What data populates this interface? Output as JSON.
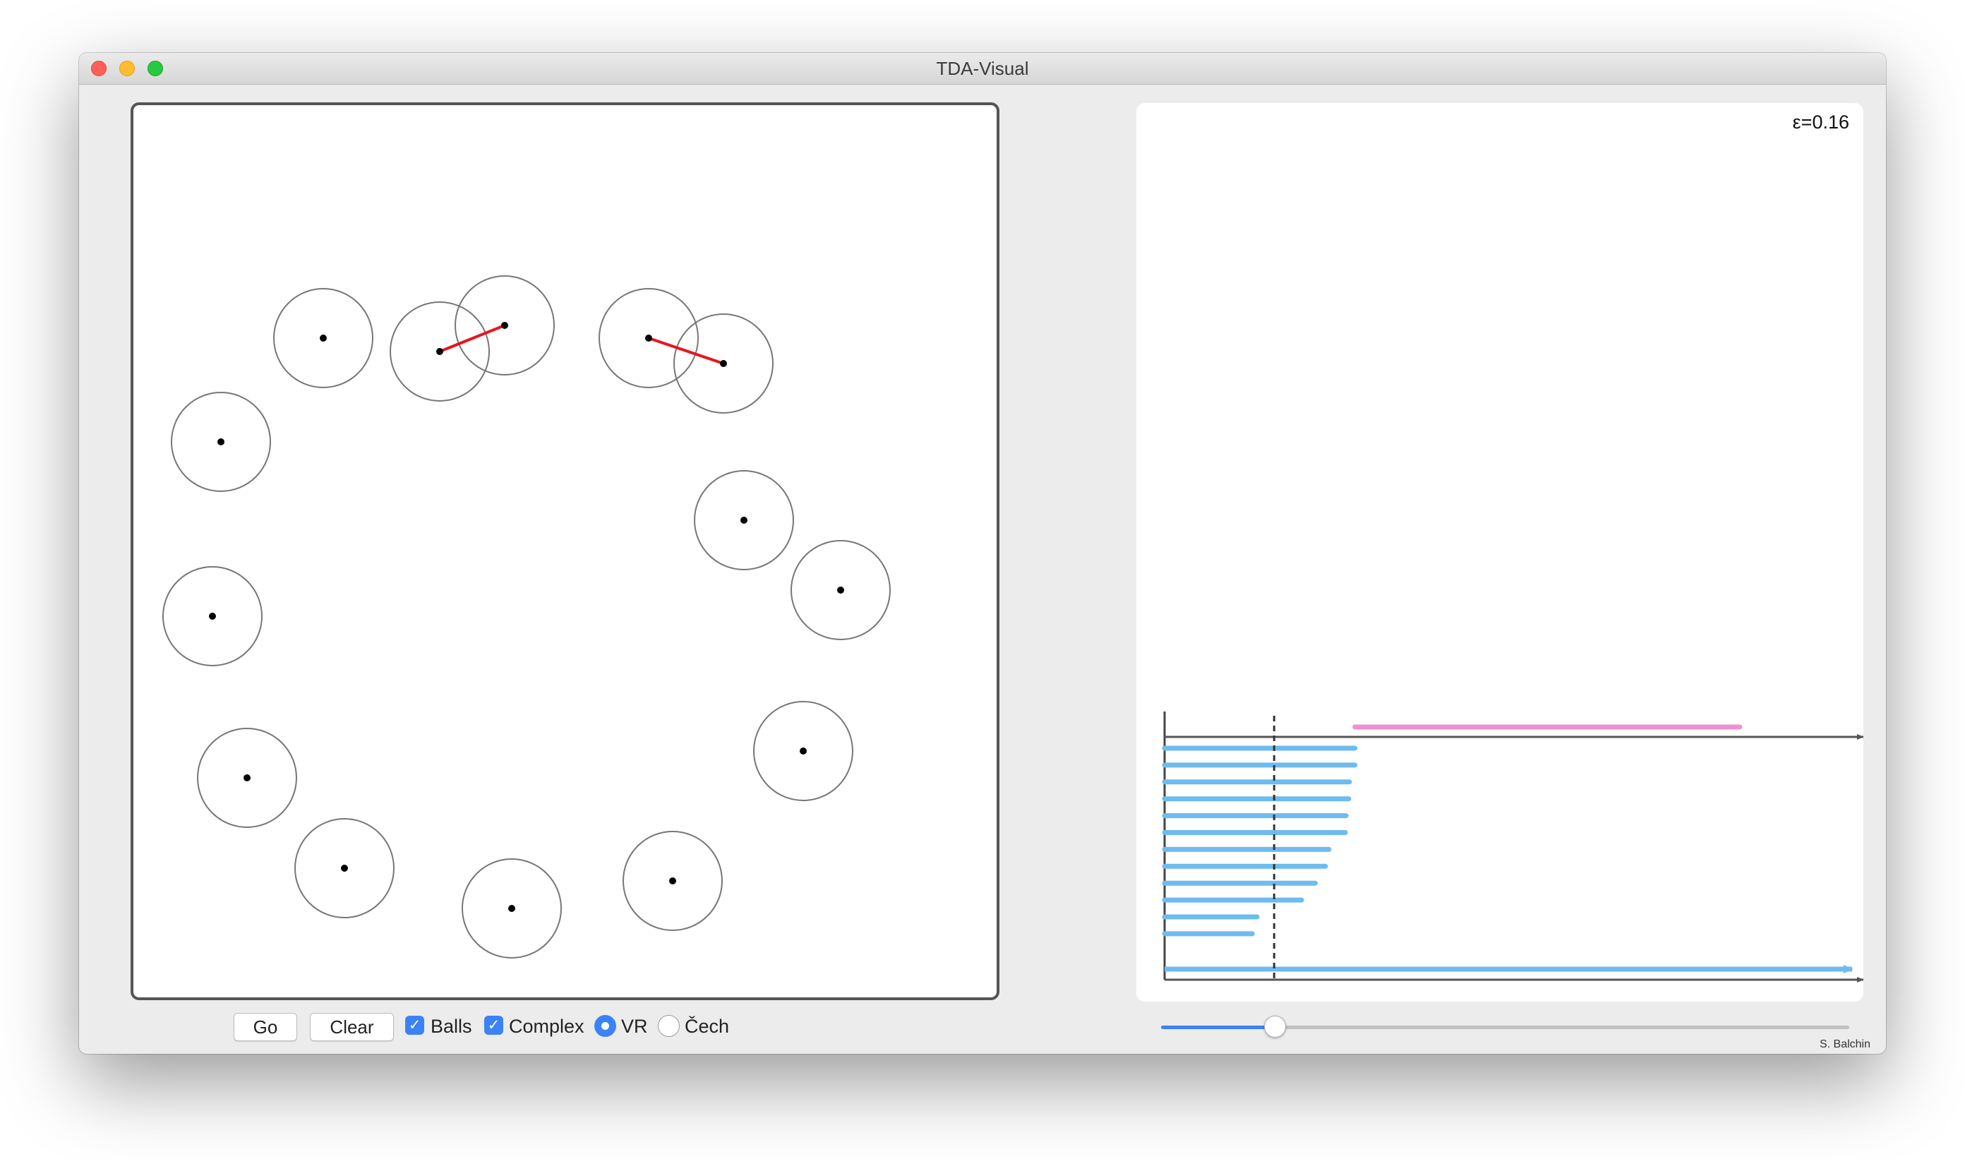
{
  "window": {
    "title": "TDA-Visual"
  },
  "controls": {
    "go_label": "Go",
    "clear_label": "Clear",
    "balls_label": "Balls",
    "balls_checked": true,
    "complex_label": "Complex",
    "complex_checked": true,
    "vr_label": "VR",
    "cech_label": "Čech",
    "selected_mode": "VR"
  },
  "epsilon": {
    "label": "ε=0.16",
    "value": 0.16
  },
  "slider": {
    "fraction": 0.165
  },
  "credit": "S. Balchin",
  "colors": {
    "edge": "#e8151b",
    "h0_bar": "#6dbbf0",
    "h1_bar": "#f08ed1",
    "accent": "#3b82f6"
  },
  "persistence": {
    "epsilon_marker": 0.16,
    "h0_deaths": [
      0.278,
      0.278,
      0.27,
      0.269,
      0.265,
      0.264,
      0.24,
      0.235,
      0.22,
      0.2,
      0.135,
      0.128
    ],
    "h0_infinite": 1,
    "h1": [
      {
        "birth": 0.278,
        "death": 0.84
      }
    ]
  }
}
